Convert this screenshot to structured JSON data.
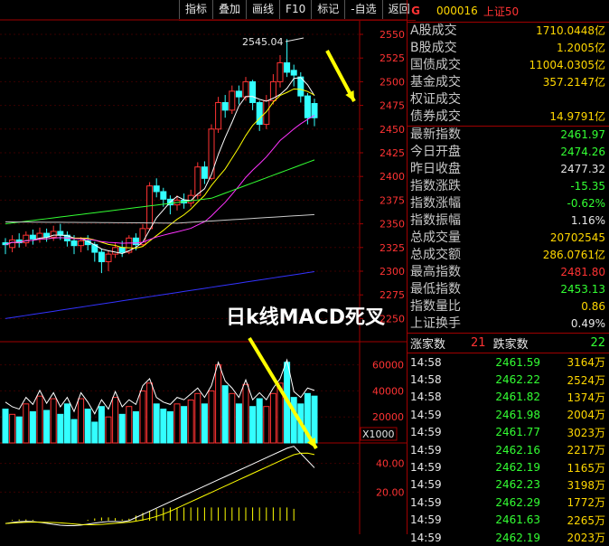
{
  "toolbar": {
    "items": [
      "指标",
      "叠加",
      "画线",
      "F10",
      "标记",
      "-自选",
      "返回"
    ]
  },
  "header": {
    "icon": "G",
    "code": "000016",
    "name": "上证50"
  },
  "stats_top": [
    {
      "label": "A股成交",
      "value": "1710.0448亿"
    },
    {
      "label": "B股成交",
      "value": "1.2005亿"
    },
    {
      "label": "国债成交",
      "value": "11004.0305亿"
    },
    {
      "label": "基金成交",
      "value": "357.2147亿"
    },
    {
      "label": "权证成交",
      "value": ""
    },
    {
      "label": "债券成交",
      "value": "14.9791亿"
    }
  ],
  "stats_index": [
    {
      "label": "最新指数",
      "value": "2461.97",
      "color": "green"
    },
    {
      "label": "今日开盘",
      "value": "2474.26",
      "color": "green"
    },
    {
      "label": "昨日收盘",
      "value": "2477.32",
      "color": "white"
    },
    {
      "label": "指数涨跌",
      "value": "-15.35",
      "color": "green"
    },
    {
      "label": "指数涨幅",
      "value": "-0.62%",
      "color": "green"
    },
    {
      "label": "指数振幅",
      "value": "1.16%",
      "color": "white"
    },
    {
      "label": "总成交量",
      "value": "20702545",
      "color": "yellow"
    },
    {
      "label": "总成交额",
      "value": "286.0761亿",
      "color": "yellow"
    },
    {
      "label": "最高指数",
      "value": "2481.80",
      "color": "red"
    },
    {
      "label": "最低指数",
      "value": "2453.13",
      "color": "green"
    },
    {
      "label": "指数量比",
      "value": "0.86",
      "color": "yellow"
    },
    {
      "label": "上证换手",
      "value": "0.49%",
      "color": "white"
    }
  ],
  "counts": {
    "up_label": "涨家数",
    "up_value": "21",
    "down_label": "跌家数",
    "down_value": "22"
  },
  "ticks": [
    {
      "time": "14:58",
      "price": "2461.59",
      "vol": "3164万"
    },
    {
      "time": "14:58",
      "price": "2462.22",
      "vol": "2524万"
    },
    {
      "time": "14:58",
      "price": "2461.82",
      "vol": "1374万"
    },
    {
      "time": "14:59",
      "price": "2461.98",
      "vol": "2004万"
    },
    {
      "time": "14:59",
      "price": "2461.77",
      "vol": "3023万"
    },
    {
      "time": "14:59",
      "price": "2462.16",
      "vol": "2217万"
    },
    {
      "time": "14:59",
      "price": "2462.19",
      "vol": "1165万"
    },
    {
      "time": "14:59",
      "price": "2462.23",
      "vol": "3198万"
    },
    {
      "time": "14:59",
      "price": "2462.29",
      "vol": "1772万"
    },
    {
      "time": "14:59",
      "price": "2461.63",
      "vol": "2265万"
    },
    {
      "time": "14:59",
      "price": "2462.19",
      "vol": "2023万"
    }
  ],
  "annotation": {
    "text": "日k线MACD死叉",
    "high_label": "2545.04"
  },
  "price_axis": {
    "ticks": [
      "2550",
      "2525",
      "2500",
      "2475",
      "2450",
      "2425",
      "2400",
      "2375",
      "2350",
      "2325",
      "2300",
      "2275",
      "2250"
    ]
  },
  "volume_axis": {
    "ticks": [
      "60000",
      "40000",
      "20000"
    ],
    "unit": "X1000"
  },
  "macd_axis": {
    "ticks": [
      "40.00",
      "20.00"
    ]
  },
  "colors": {
    "up": "#ff3333",
    "down": "#33ffff",
    "ma5": "#ffffff",
    "ma10": "#ffff00",
    "ma20": "#ff33ff",
    "ma30": "#33ff33",
    "ma60": "#c8c8c8",
    "ma120": "#3333ff",
    "arrow": "#ffff00"
  }
}
